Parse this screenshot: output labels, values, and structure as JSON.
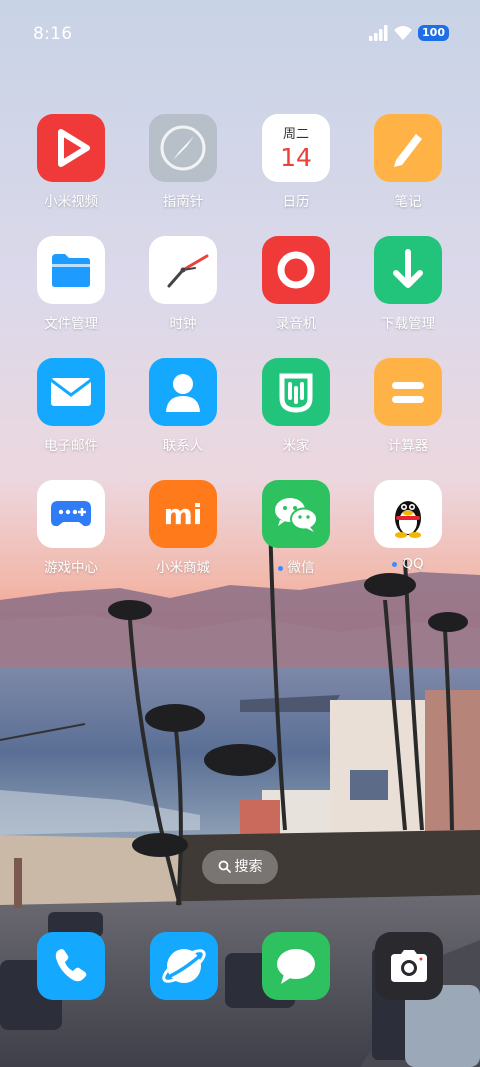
{
  "status_bar": {
    "time": "8:16",
    "battery": "100"
  },
  "apps": [
    {
      "label": "小米视频",
      "icon": "video-play-icon",
      "dot": false
    },
    {
      "label": "指南针",
      "icon": "compass-icon",
      "dot": false
    },
    {
      "label": "日历",
      "icon": "calendar-icon",
      "dot": false,
      "weekday": "周二",
      "day": "14"
    },
    {
      "label": "笔记",
      "icon": "pencil-icon",
      "dot": false
    },
    {
      "label": "文件管理",
      "icon": "folder-icon",
      "dot": false
    },
    {
      "label": "时钟",
      "icon": "clock-icon",
      "dot": false
    },
    {
      "label": "录音机",
      "icon": "record-icon",
      "dot": false
    },
    {
      "label": "下载管理",
      "icon": "download-icon",
      "dot": false
    },
    {
      "label": "电子邮件",
      "icon": "mail-icon",
      "dot": false
    },
    {
      "label": "联系人",
      "icon": "contact-icon",
      "dot": false
    },
    {
      "label": "米家",
      "icon": "mijia-icon",
      "dot": false
    },
    {
      "label": "计算器",
      "icon": "calculator-icon",
      "dot": false
    },
    {
      "label": "游戏中心",
      "icon": "gamepad-icon",
      "dot": false
    },
    {
      "label": "小米商城",
      "icon": "mi-logo-icon",
      "dot": false,
      "logo_text": "mi"
    },
    {
      "label": "微信",
      "icon": "wechat-icon",
      "dot": true
    },
    {
      "label": "QQ",
      "icon": "qq-penguin-icon",
      "dot": true
    }
  ],
  "search_button": {
    "label": "搜索"
  },
  "dock": [
    {
      "icon": "phone-icon"
    },
    {
      "icon": "browser-icon"
    },
    {
      "icon": "messages-icon"
    },
    {
      "icon": "camera-icon"
    }
  ],
  "colors": {
    "video": "#f03a3a",
    "compass": "#b7c0c8",
    "calendar_day": "#e8423a",
    "notes": "#ffb347",
    "files": "#1e9bff",
    "recorder": "#f03a3a",
    "download": "#22c37a",
    "mail": "#14a8ff",
    "contacts": "#14a8ff",
    "mijia": "#22c37a",
    "calculator": "#ffb347",
    "game": "#2f7cf6",
    "mall": "#ff7a1a",
    "wechat": "#2dc15f",
    "notification_dot": "#3a8cff",
    "battery": "#1c6fe6"
  }
}
